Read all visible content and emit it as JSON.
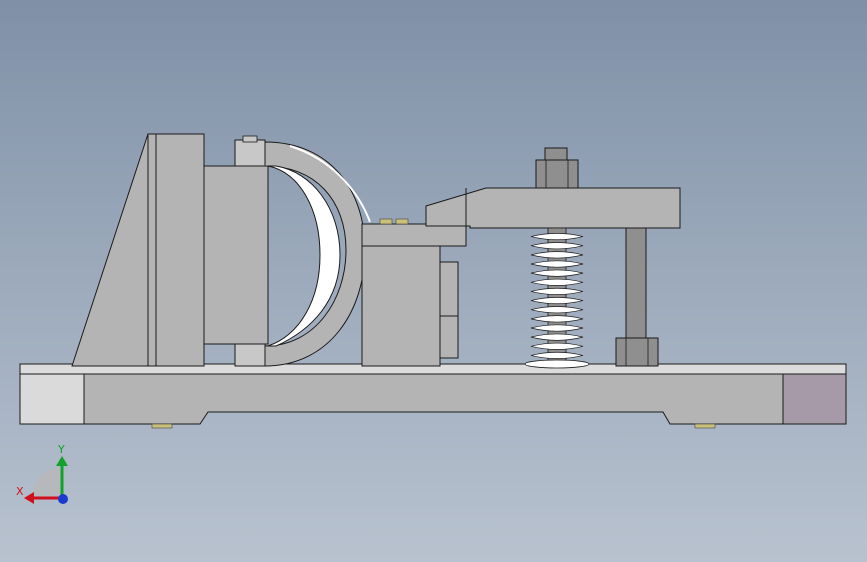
{
  "viewport": {
    "background_top": "#7f90a7",
    "background_bottom": "#b8c2cf",
    "part_color": "#b4b4b4",
    "edge_color": "#1a1a1a",
    "spring_color": "#ffffff",
    "pin_color": "#c8c8c8",
    "purple_block_color": "#a79aa8",
    "light_block_color": "#dadada",
    "washer_color": "#c9c07a"
  },
  "triad": {
    "x_label": "X",
    "y_label": "Y",
    "x_color": "#d0101c",
    "y_color": "#12a12a",
    "z_color": "#1a3ad0"
  }
}
